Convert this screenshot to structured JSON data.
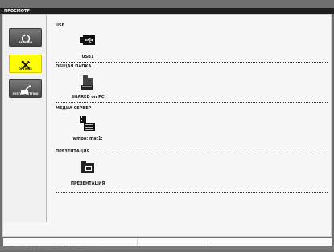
{
  "title_bar": {
    "title": "ПРОСМОТР"
  },
  "sidebar": {
    "items": [
      {
        "label": "REFRESH",
        "icon": "refresh-icon",
        "active": false
      },
      {
        "label": "OPTIONS",
        "icon": "tools-icon",
        "active": true
      },
      {
        "label": "SYSTEM SETTING",
        "icon": "system-setting-icon",
        "active": false
      }
    ]
  },
  "sections": [
    {
      "title": "USB",
      "item_label": "USB1",
      "icon": "usb-drive-icon"
    },
    {
      "title": "ОБЩАЯ ПАПКА",
      "item_label": "SHARED on PC",
      "icon": "shared-folder-icon"
    },
    {
      "title": "МЕДИА СЕРВЕР",
      "item_label": "wmpo: mat1:",
      "icon": "media-server-icon"
    },
    {
      "title": "ПРЕЗЕНТАЦИЯ",
      "item_label": "ПРЕЗЕНТАЦИЯ",
      "icon": "presentation-folder-icon"
    }
  ],
  "status": {
    "message": "УСТАНОВИТЕ ПАРАМЕТРЫ ПРОСМОТРЩИКА."
  },
  "colors": {
    "active_button": "#ffff00",
    "title_bar": "#1f1f1f",
    "background": "#f7f7f7"
  }
}
